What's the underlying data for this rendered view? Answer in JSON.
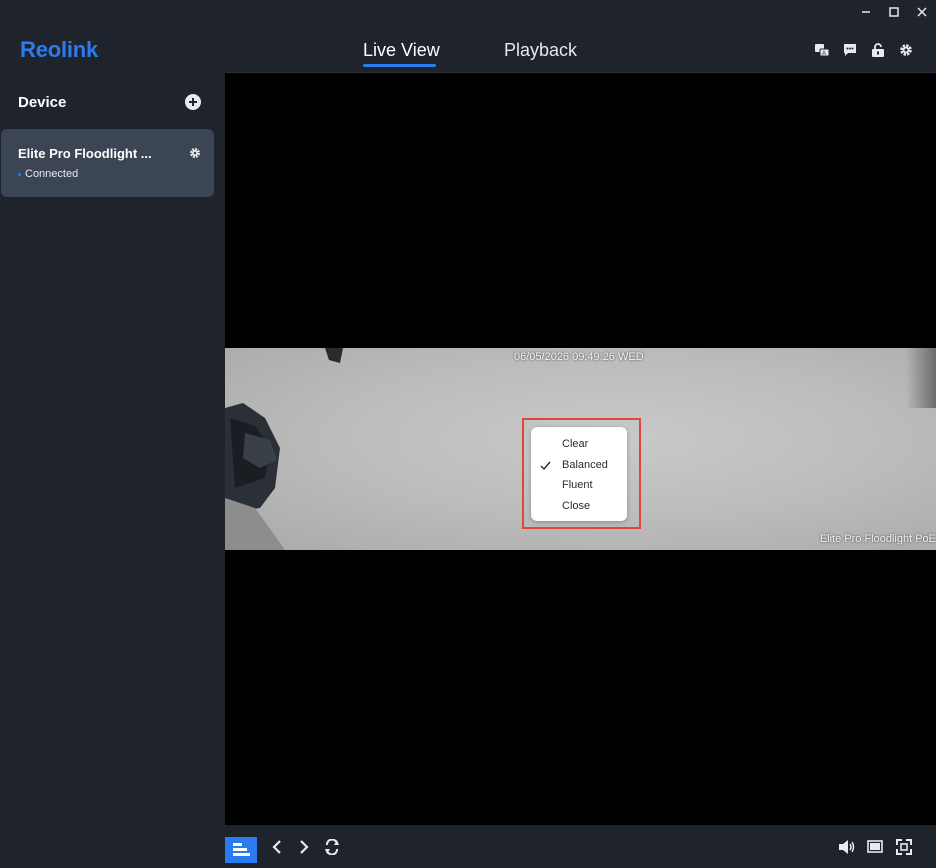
{
  "window": {
    "controls": {
      "minimize_icon": "minimize-icon",
      "maximize_icon": "maximize-icon",
      "close_icon": "close-icon"
    }
  },
  "header": {
    "logo": "Reolink",
    "tabs": [
      {
        "label": "Live View",
        "active": true
      },
      {
        "label": "Playback",
        "active": false
      }
    ],
    "icons": [
      "language-icon",
      "message-icon",
      "lock-icon",
      "settings-icon"
    ],
    "accent_color": "#2a7cf0"
  },
  "sidebar": {
    "title": "Device",
    "add_icon": "add-icon",
    "devices": [
      {
        "name": "Elite Pro Floodlight ...",
        "status": "Connected"
      }
    ]
  },
  "video": {
    "timestamp": "06/05/2026 09:49:26 WED",
    "camera_label": "Elite Pro Floodlight PoE",
    "stream_menu": {
      "items": [
        {
          "label": "Clear",
          "checked": false
        },
        {
          "label": "Balanced",
          "checked": true
        },
        {
          "label": "Fluent",
          "checked": false
        },
        {
          "label": "Close",
          "checked": false
        }
      ],
      "highlight_color": "#e0463d"
    }
  },
  "toolbar": {
    "left_icons": [
      "layout-icon",
      "previous-icon",
      "next-icon",
      "refresh-icon"
    ],
    "right_icons": [
      "volume-icon",
      "screen-icon",
      "fullscreen-icon"
    ]
  }
}
